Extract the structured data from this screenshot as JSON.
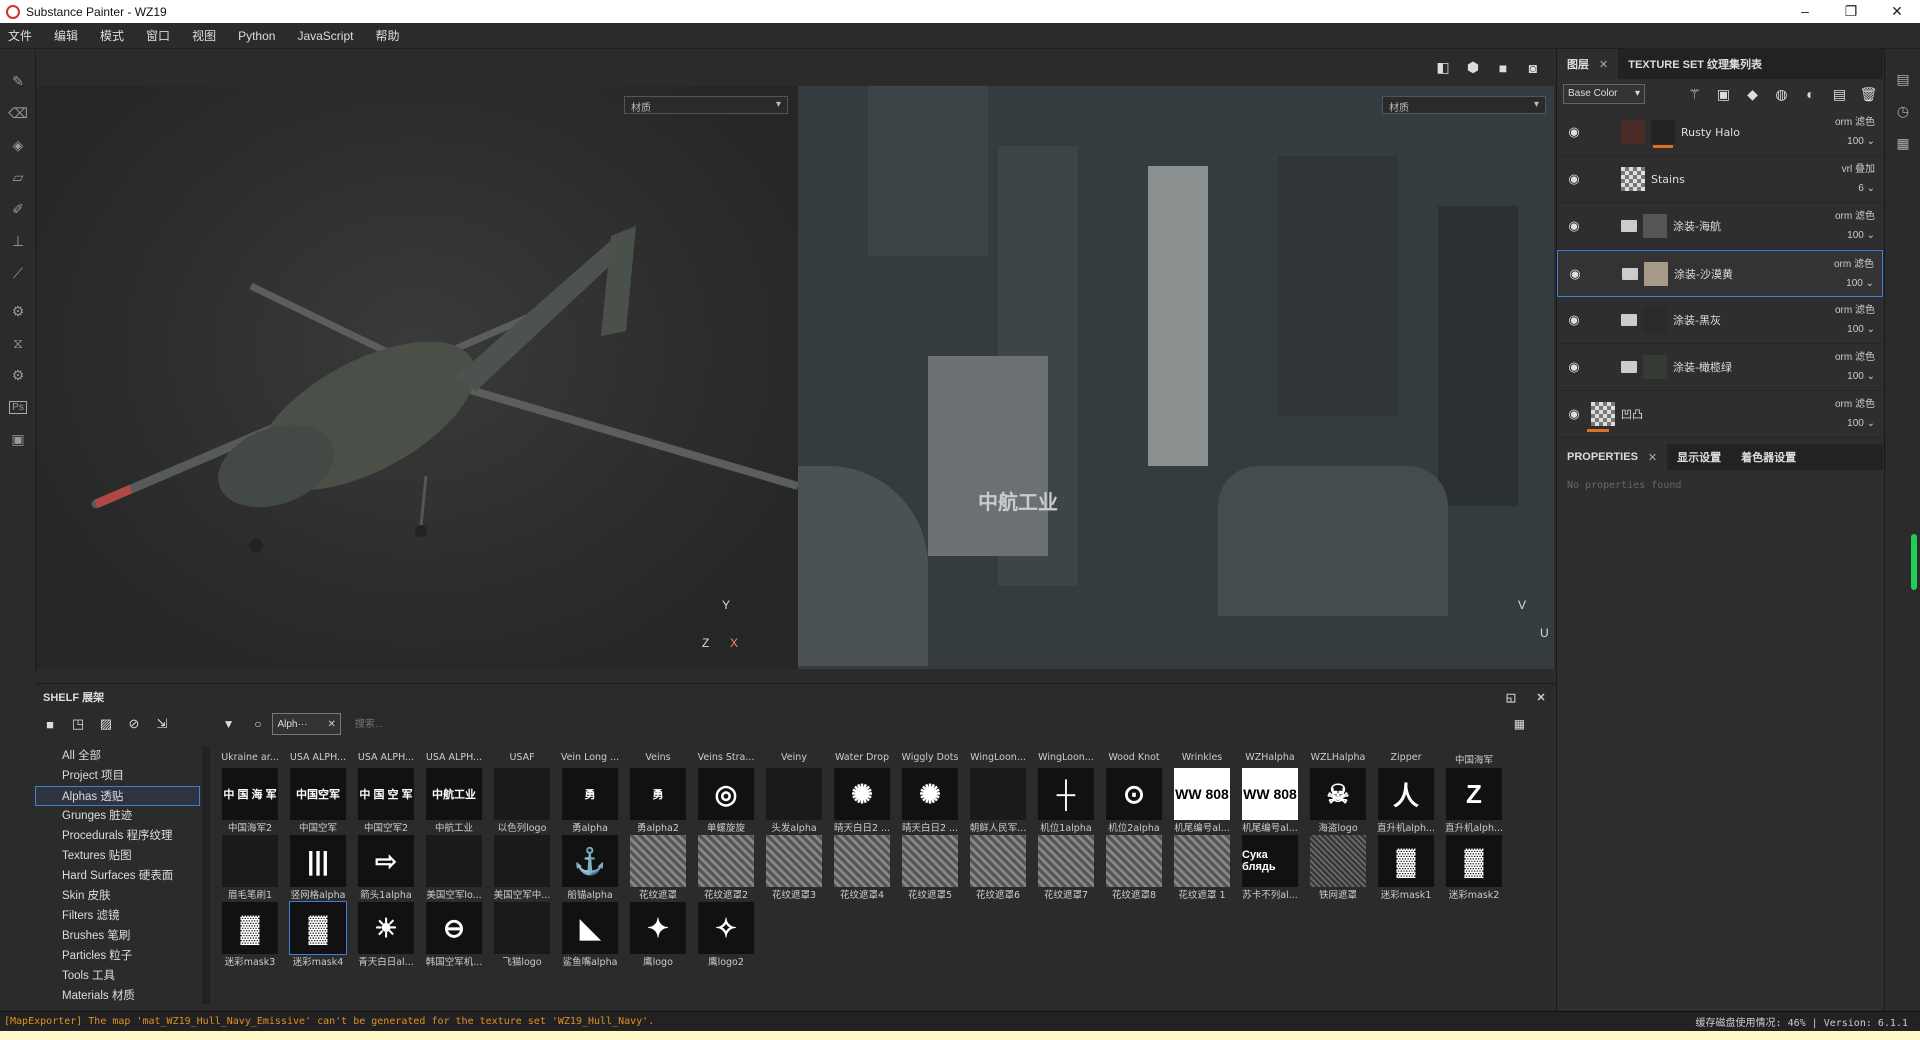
{
  "window": {
    "title": "Substance Painter - WZ19",
    "controls": [
      "–",
      "❐",
      "✕"
    ]
  },
  "menu": [
    "文件",
    "编辑",
    "模式",
    "窗口",
    "视图",
    "Python",
    "JavaScript",
    "帮助"
  ],
  "viewport": {
    "left_material": "材质",
    "right_material": "材质",
    "axis_left": {
      "y": "Y",
      "z": "Z",
      "x": "X"
    },
    "axis_right": {
      "v": "V",
      "u": "U"
    }
  },
  "right_tabs": {
    "layers": "图层",
    "texture_set": "TEXTURE SET 纹理集列表"
  },
  "channel_select": "Base Color",
  "layers": [
    {
      "name": "Rusty Halo",
      "blend": "orm 滤色",
      "opacity": "100"
    },
    {
      "name": "Stains",
      "blend": "vrl 叠加",
      "opacity": "6"
    },
    {
      "name": "涂装-海航",
      "blend": "orm 滤色",
      "opacity": "100"
    },
    {
      "name": "涂装-沙漠黄",
      "blend": "orm 滤色",
      "opacity": "100"
    },
    {
      "name": "涂装-黑灰",
      "blend": "orm 滤色",
      "opacity": "100"
    },
    {
      "name": "涂装-橄榄绿",
      "blend": "orm 滤色",
      "opacity": "100"
    },
    {
      "name": "凹凸",
      "blend": "orm 滤色",
      "opacity": "100"
    }
  ],
  "properties_tabs": {
    "properties": "PROPERTIES",
    "display": "显示设置",
    "shader": "着色器设置"
  },
  "properties_empty": "No properties found",
  "shelf": {
    "title": "SHELF 展架",
    "filter_chip": "Alph···",
    "search_placeholder": "搜索...",
    "categories": [
      "All 全部",
      "Project 项目",
      "Alphas 透贴",
      "Grunges 脏迹",
      "Procedurals 程序纹理",
      "Textures 贴图",
      "Hard Surfaces 硬表面",
      "Skin 皮肤",
      "Filters 滤镜",
      "Brushes 笔刷",
      "Particles 粒子",
      "Tools 工具",
      "Materials 材质"
    ],
    "row0": [
      "Ukraine ar...",
      "USA ALPH...",
      "USA ALPH...",
      "USA ALPH...",
      "USAF",
      "Vein Long ...",
      "Veins",
      "Veins Stra...",
      "Veiny",
      "Water Drop",
      "Wiggly Dots",
      "WingLoon...",
      "WingLoon...",
      "Wood Knot",
      "Wrinkles",
      "WZHalpha",
      "WZLHalpha",
      "Zipper",
      "中国海军"
    ],
    "row1": [
      "中国海军2",
      "中国空军",
      "中国空军2",
      "中航工业",
      "以色列logo",
      "勇alpha",
      "勇alpha2",
      "单螺旋旋",
      "头发alpha",
      "晴天白日2 ...",
      "晴天白日2 ...",
      "朝鲜人民军...",
      "机位1alpha",
      "机位2alpha",
      "机尾编号al...",
      "机尾编号al...",
      "海盗logo",
      "直升机alph...",
      "直升机alph..."
    ],
    "row2": [
      "眉毛笔刷1",
      "竖网格alpha",
      "箭头1alpha",
      "美国空军lo...",
      "美国空军中...",
      "船锚alpha",
      "花纹遮罩",
      "花纹遮罩2",
      "花纹遮罩3",
      "花纹遮罩4",
      "花纹遮罩5",
      "花纹遮罩6",
      "花纹遮罩7",
      "花纹遮罩8",
      "花纹遮罩 1",
      "苏卡不列al...",
      "铁网遮罩",
      "迷彩mask1",
      "迷彩mask2"
    ],
    "row3": [
      "迷彩mask3",
      "迷彩mask4",
      "青天白日al...",
      "韩国空军机...",
      "飞猫logo",
      "鲨鱼嘴alpha",
      "鹰logo",
      "鹰logo2"
    ],
    "thumb_text": {
      "zhhj": "中 国 海 军",
      "zgkj": "中国空军",
      "zgkj2": "中 国 空 军",
      "zhgy": "中航工业",
      "yong": "勇",
      "ww1": "WW 808",
      "ww2": "WW 808",
      "suka": "Сука блядь"
    }
  },
  "status": {
    "message": "[MapExporter] The map 'mat_WZ19_Hull_Navy_Emissive' can't be generated for the texture set 'WZ19_Hull_Navy'.",
    "cache_label": "缓存磁盘使用情况: 46%",
    "version": "Version: 6.1.1"
  },
  "colors": {
    "accent": "#3f7fd6",
    "warning": "#e09020",
    "panel": "#2e2e2e"
  }
}
